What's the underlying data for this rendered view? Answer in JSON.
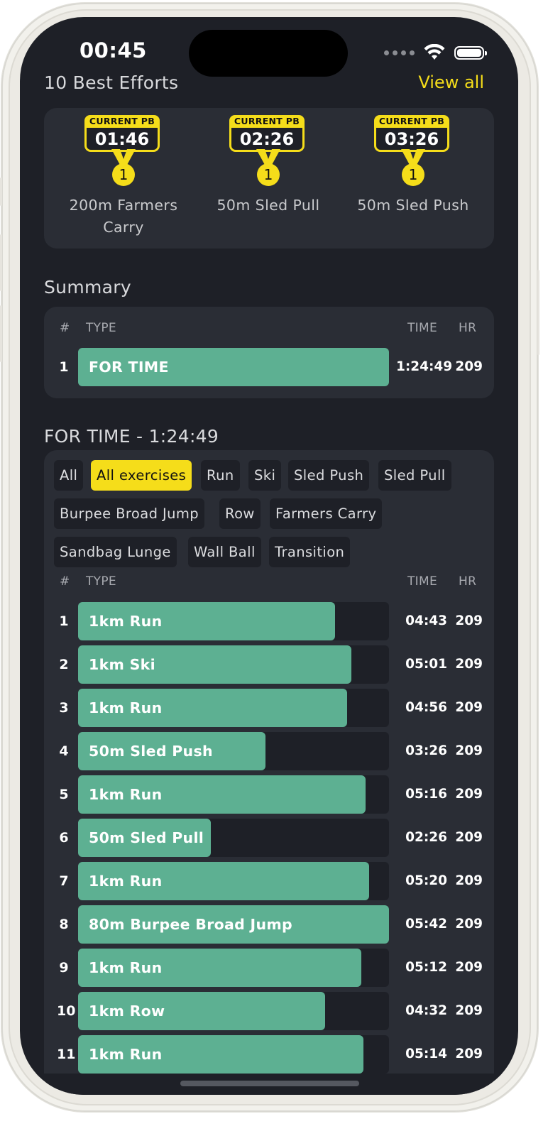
{
  "status_bar": {
    "time": "00:45"
  },
  "best_efforts": {
    "title": "10 Best Efforts",
    "view_all": "View all",
    "items": [
      {
        "tag": "CURRENT PB",
        "time": "01:46",
        "rank": "1",
        "label_line1": "200m Farmers",
        "label_line2": "Carry"
      },
      {
        "tag": "CURRENT PB",
        "time": "02:26",
        "rank": "1",
        "label_line1": "50m Sled Pull",
        "label_line2": ""
      },
      {
        "tag": "CURRENT PB",
        "time": "03:26",
        "rank": "1",
        "label_line1": "50m Sled Push",
        "label_line2": ""
      }
    ]
  },
  "summary": {
    "title": "Summary",
    "headers": {
      "num": "#",
      "type": "TYPE",
      "time": "TIME",
      "hr": "HR"
    },
    "rows": [
      {
        "num": "1",
        "type": "FOR TIME",
        "time": "1:24:49",
        "hr": "209",
        "fill": 1.0
      }
    ]
  },
  "detail": {
    "title": "FOR TIME - 1:24:49",
    "filters": [
      "All",
      "All exercises",
      "Run",
      "Ski",
      "Sled Push",
      "Sled Pull",
      "Burpee Broad Jump",
      "Row",
      "Farmers Carry",
      "Sandbag Lunge",
      "Wall Ball",
      "Transition"
    ],
    "active_filter": "All exercises",
    "headers": {
      "num": "#",
      "type": "TYPE",
      "time": "TIME",
      "hr": "HR"
    },
    "rows": [
      {
        "num": "1",
        "type": "1km Run",
        "time": "04:43",
        "hr": "209",
        "fill": 0.827
      },
      {
        "num": "2",
        "type": "1km Ski",
        "time": "05:01",
        "hr": "209",
        "fill": 0.88
      },
      {
        "num": "3",
        "type": "1km Run",
        "time": "04:56",
        "hr": "209",
        "fill": 0.865
      },
      {
        "num": "4",
        "type": "50m Sled Push",
        "time": "03:26",
        "hr": "209",
        "fill": 0.602
      },
      {
        "num": "5",
        "type": "1km Run",
        "time": "05:16",
        "hr": "209",
        "fill": 0.924
      },
      {
        "num": "6",
        "type": "50m Sled Pull",
        "time": "02:26",
        "hr": "209",
        "fill": 0.427
      },
      {
        "num": "7",
        "type": "1km Run",
        "time": "05:20",
        "hr": "209",
        "fill": 0.936
      },
      {
        "num": "8",
        "type": "80m Burpee Broad Jump",
        "time": "05:42",
        "hr": "209",
        "fill": 1.0
      },
      {
        "num": "9",
        "type": "1km Run",
        "time": "05:12",
        "hr": "209",
        "fill": 0.912
      },
      {
        "num": "10",
        "type": "1km Row",
        "time": "04:32",
        "hr": "209",
        "fill": 0.795
      },
      {
        "num": "11",
        "type": "1km Run",
        "time": "05:14",
        "hr": "209",
        "fill": 0.918
      }
    ]
  },
  "colors": {
    "accent": "#f5dd1a",
    "bar": "#5db092",
    "background": "#1e2027",
    "card": "#2a2d35"
  }
}
